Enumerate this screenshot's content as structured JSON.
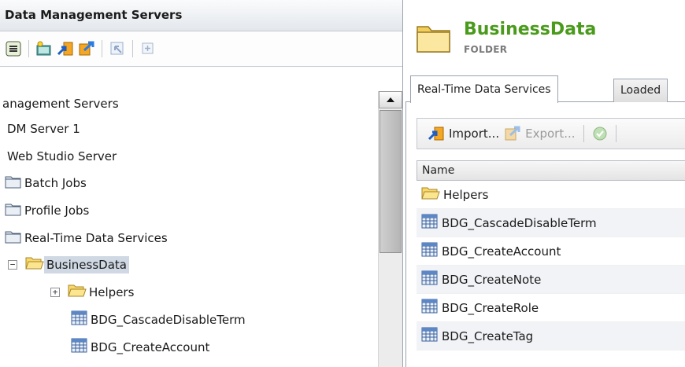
{
  "left_panel": {
    "title": "Data Management Servers",
    "toolbar": [
      {
        "name": "panel-menu-icon",
        "interactable": true
      },
      {
        "name": "new-folder-icon",
        "interactable": true
      },
      {
        "name": "import-icon",
        "interactable": true
      },
      {
        "name": "export-icon",
        "interactable": true
      },
      {
        "name": "properties-icon",
        "interactable": false
      },
      {
        "name": "expand-icon",
        "interactable": false
      }
    ],
    "tree": [
      {
        "label": "anagement Servers",
        "type": "none"
      },
      {
        "label": "DM Server 1",
        "type": "none"
      },
      {
        "label": "Web Studio Server",
        "type": "none"
      },
      {
        "label": "Batch Jobs",
        "type": "folder-closed"
      },
      {
        "label": "Profile Jobs",
        "type": "folder-closed"
      },
      {
        "label": "Real-Time Data Services",
        "type": "folder-closed"
      },
      {
        "label": "BusinessData",
        "type": "folder-open",
        "expander": "−",
        "selected": true
      },
      {
        "label": "Helpers",
        "type": "folder-open",
        "expander": "+"
      },
      {
        "label": "BDG_CascadeDisableTerm",
        "type": "service"
      },
      {
        "label": "BDG_CreateAccount",
        "type": "service"
      }
    ]
  },
  "right_panel": {
    "folder_name": "BusinessData",
    "folder_type": "FOLDER",
    "tabs": [
      {
        "label": "Real-Time Data Services",
        "active": true
      },
      {
        "label": "Loaded",
        "active": false
      }
    ],
    "toolbar": {
      "import_label": "Import...",
      "export_label": "Export..."
    },
    "grid": {
      "column_header": "Name",
      "rows": [
        {
          "label": "Helpers",
          "type": "folder"
        },
        {
          "label": "BDG_CascadeDisableTerm",
          "type": "service"
        },
        {
          "label": "BDG_CreateAccount",
          "type": "service"
        },
        {
          "label": "BDG_CreateNote",
          "type": "service"
        },
        {
          "label": "BDG_CreateRole",
          "type": "service"
        },
        {
          "label": "BDG_CreateTag",
          "type": "service"
        }
      ]
    }
  },
  "colors": {
    "folder_name": "#4a9a1c",
    "selection": "#cfd8e3",
    "row_alt": "#f1f3f6",
    "folder_yellow": "#f7d868"
  }
}
